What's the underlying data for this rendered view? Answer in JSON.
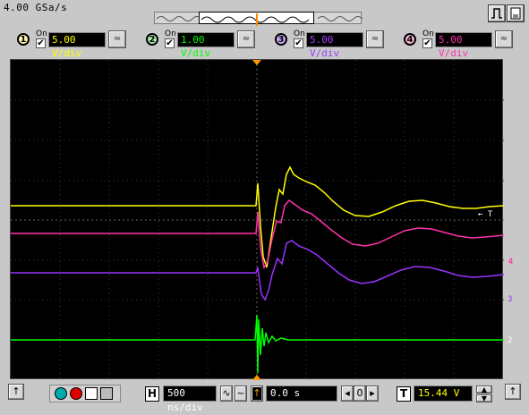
{
  "top": {
    "sample_rate": "4.00 GSa/s"
  },
  "channels": [
    {
      "num": "1",
      "on_label": "On",
      "checked": "✔",
      "scale": "5.00 V/div",
      "color": "#ffff00",
      "badge": "#f5f0a0"
    },
    {
      "num": "2",
      "on_label": "On",
      "checked": "✔",
      "scale": "1.00 V/div",
      "color": "#00ff00",
      "badge": "#b0f0b0"
    },
    {
      "num": "3",
      "on_label": "On",
      "checked": "✔",
      "scale": "5.00 V/div",
      "color": "#9933ff",
      "badge": "#d0b0ff"
    },
    {
      "num": "4",
      "on_label": "On",
      "checked": "✔",
      "scale": "5.00 V/div",
      "color": "#ff33aa",
      "badge": "#ffb0d8"
    }
  ],
  "markers": {
    "trigger": "← T",
    "ch4": "4",
    "ch3": "3",
    "ch2": "2"
  },
  "bottom": {
    "horizontal_letter": "H",
    "time_scale": "500 ns/div",
    "delay": "0.0 s",
    "zero_label": "0",
    "trigger_letter": "T",
    "trigger_level": "15.44 V"
  }
}
